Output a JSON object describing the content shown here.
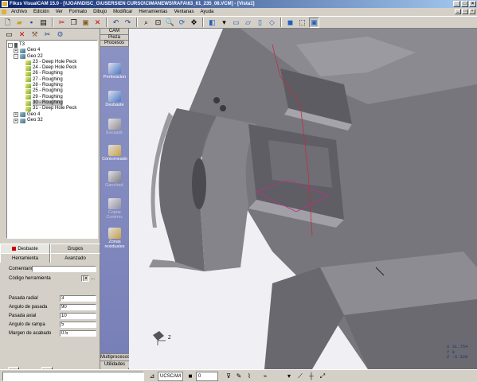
{
  "window": {
    "title": "Fikus VisualCAM 15.0 - [\\\\JOAN\\DISC_G\\USERS\\EN CURSO\\CIMANEWS\\RAFA\\63_61_235_08.VCM] - [Vista1]",
    "buttons": [
      "_",
      "□",
      "×"
    ]
  },
  "menu": {
    "items": [
      "Archivo",
      "Edición",
      "Ver",
      "Formato",
      "Dibujo",
      "Modificar",
      "Herramientas",
      "Ventanas",
      "Ayuda"
    ],
    "mdi_buttons": [
      "_",
      "□",
      "×"
    ]
  },
  "left_toolbar": {
    "icons": [
      "monitor-icon",
      "delete-icon",
      "tool-icon",
      "cut-icon",
      "settings-icon"
    ]
  },
  "tree": {
    "rows": [
      {
        "expander": "-",
        "icon": "tool",
        "label": "T3",
        "indent": 0
      },
      {
        "expander": "+",
        "icon": "geo",
        "label": "Geo 4",
        "indent": 1
      },
      {
        "expander": "-",
        "icon": "geo",
        "label": "Geo 22",
        "indent": 1
      },
      {
        "expander": "",
        "icon": "op",
        "label": "23 - Deep Hole Peck",
        "indent": 2
      },
      {
        "expander": "",
        "icon": "op",
        "label": "24 - Deep Hole Peck",
        "indent": 2
      },
      {
        "expander": "",
        "icon": "op",
        "label": "26 - Roughing",
        "indent": 2
      },
      {
        "expander": "",
        "icon": "op",
        "label": "27 - Roughing",
        "indent": 2
      },
      {
        "expander": "",
        "icon": "op",
        "label": "28 - Roughing",
        "indent": 2
      },
      {
        "expander": "",
        "icon": "op",
        "label": "25 - Roughing",
        "indent": 2
      },
      {
        "expander": "",
        "icon": "op",
        "label": "29 - Roughing",
        "indent": 2
      },
      {
        "expander": "",
        "icon": "op",
        "label": "30 - Roughing",
        "indent": 2,
        "selected": true
      },
      {
        "expander": "",
        "icon": "op",
        "label": "31 - Deep Hole Peck",
        "indent": 2
      },
      {
        "expander": "+",
        "icon": "geo",
        "label": "Geo 4",
        "indent": 1
      },
      {
        "expander": "+",
        "icon": "geo",
        "label": "Geo 32",
        "indent": 1
      }
    ]
  },
  "tabs": {
    "row1": [
      {
        "label": "Desbaste",
        "active": true
      },
      {
        "label": "Grupos",
        "active": false
      }
    ],
    "row2": [
      {
        "label": "Herramienta",
        "active": false
      },
      {
        "label": "Avanzado",
        "active": false
      }
    ]
  },
  "form": {
    "comentario_label": "Comentario:",
    "comentario_value": "",
    "codigo_label": "Código herramienta",
    "codigo_value": "",
    "ellipsis": "...",
    "fields": [
      {
        "label": "Pasada radial",
        "value": "3"
      },
      {
        "label": "Angulo de pasada",
        "value": "90"
      },
      {
        "label": "Pasada axial",
        "value": "10"
      },
      {
        "label": "Angulo de rampa",
        "value": "5"
      },
      {
        "label": "Margen de acabado",
        "value": "0.5"
      }
    ]
  },
  "strip": {
    "headers": [
      "CAM",
      "Pieza",
      "Procesos"
    ],
    "items": [
      {
        "label": "Perforacion",
        "color": "#4a78c8",
        "enabled": true
      },
      {
        "label": "Desbaste",
        "color": "#4a78c8",
        "enabled": true
      },
      {
        "label": "Escuadr.",
        "color": "#909090",
        "enabled": false
      },
      {
        "label": "Contorneado",
        "color": "#c8a040",
        "enabled": true
      },
      {
        "label": "Ganched.",
        "color": "#808080",
        "enabled": false
      },
      {
        "label": "Copiar Contrno.",
        "color": "#9090a0",
        "enabled": false
      },
      {
        "label": "Zonas residuales",
        "color": "#c8a040",
        "enabled": true
      }
    ],
    "footers": [
      "Multiprocesos",
      "Utilidades"
    ]
  },
  "viewport": {
    "coords": [
      "X 31.754",
      "Y 0",
      "Z -5.328"
    ],
    "axis_label": "Z",
    "background": "#f0f0f4",
    "part_color": "#7c7c80"
  },
  "statusbar": {
    "ucs": "UCSCAM",
    "layer": "0",
    "command": ""
  }
}
